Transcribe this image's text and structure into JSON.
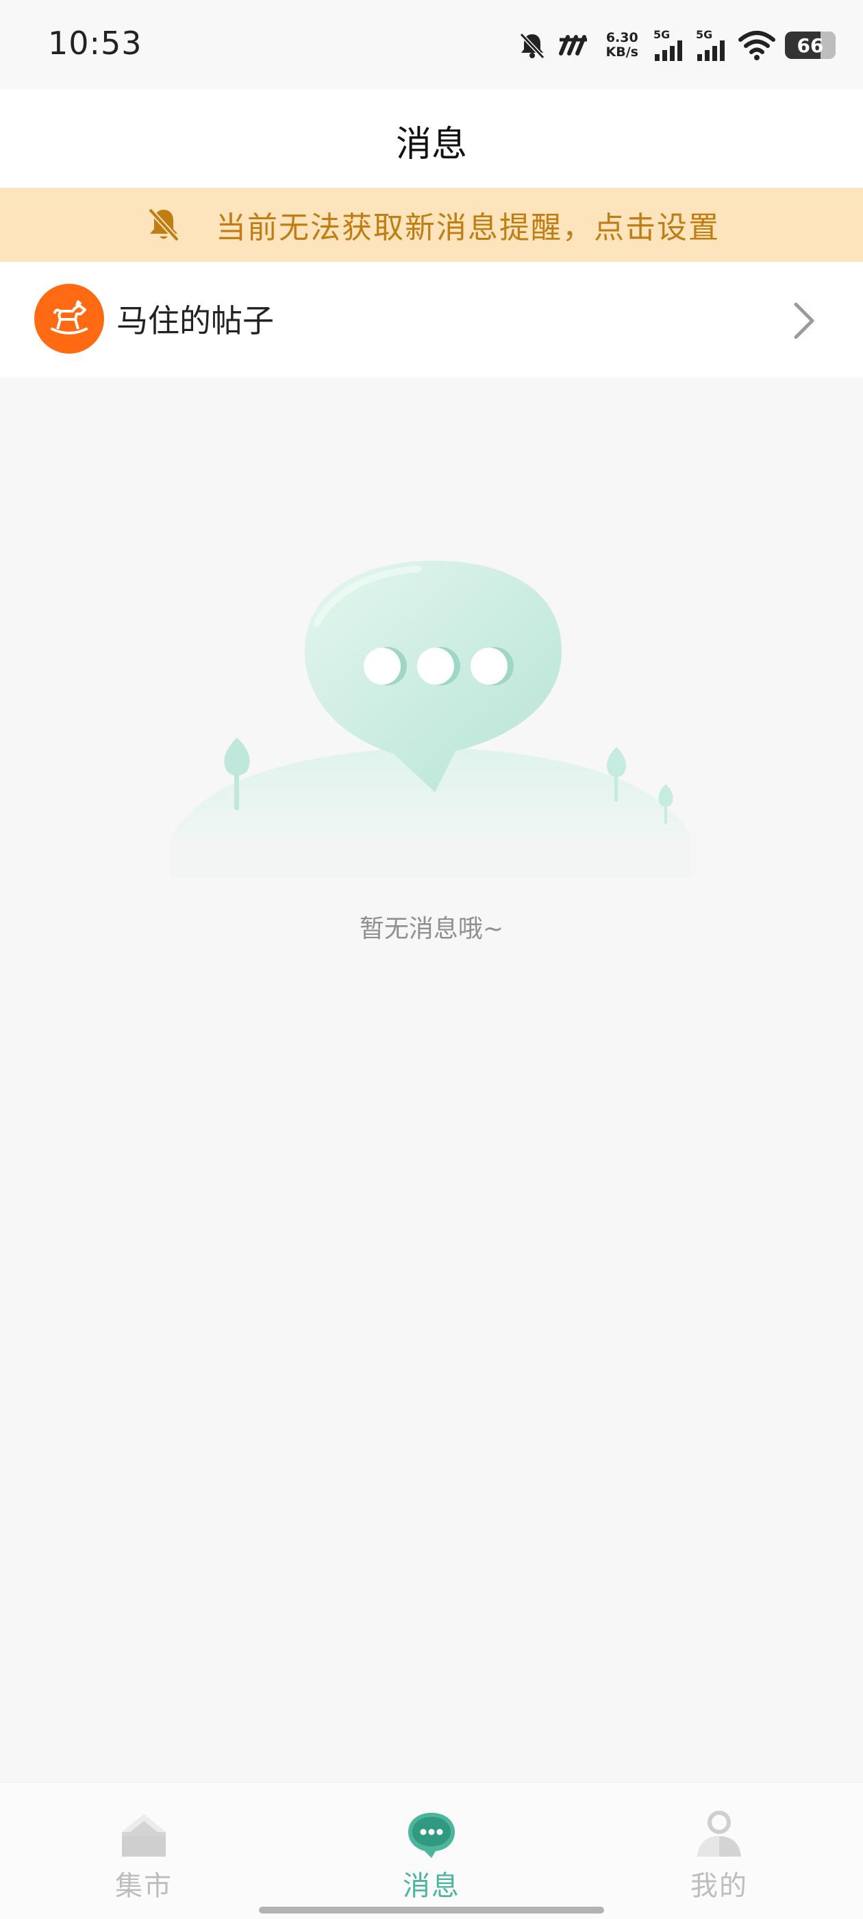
{
  "status_bar": {
    "time": "10:53",
    "net_speed_value": "6.30",
    "net_speed_unit": "KB/s",
    "signal1_label": "5G",
    "signal2_label": "5G",
    "battery": "66",
    "icons": [
      "bell-mute-icon",
      "nfc-icon",
      "signal-icon",
      "signal-icon",
      "wifi-icon",
      "battery-icon"
    ]
  },
  "header": {
    "title": "消息"
  },
  "banner": {
    "text": "当前无法获取新消息提醒，点击设置",
    "icon": "bell-mute-icon",
    "bg_color": "#fde4bc",
    "text_color": "#c07d12"
  },
  "post_row": {
    "label": "马住的帖子",
    "avatar_icon": "rocking-horse-icon",
    "avatar_color": "#ff6a13",
    "chevron_icon": "chevron-right-icon"
  },
  "empty_state": {
    "text": "暂无消息哦~",
    "illustration": "chat-bubble-icon"
  },
  "bottom_nav": {
    "items": [
      {
        "label": "集市",
        "icon": "market-icon",
        "active": false
      },
      {
        "label": "消息",
        "icon": "chat-icon",
        "active": true
      },
      {
        "label": "我的",
        "icon": "profile-icon",
        "active": false
      }
    ],
    "active_color": "#4cb59c",
    "inactive_color": "#bdbdbd"
  }
}
